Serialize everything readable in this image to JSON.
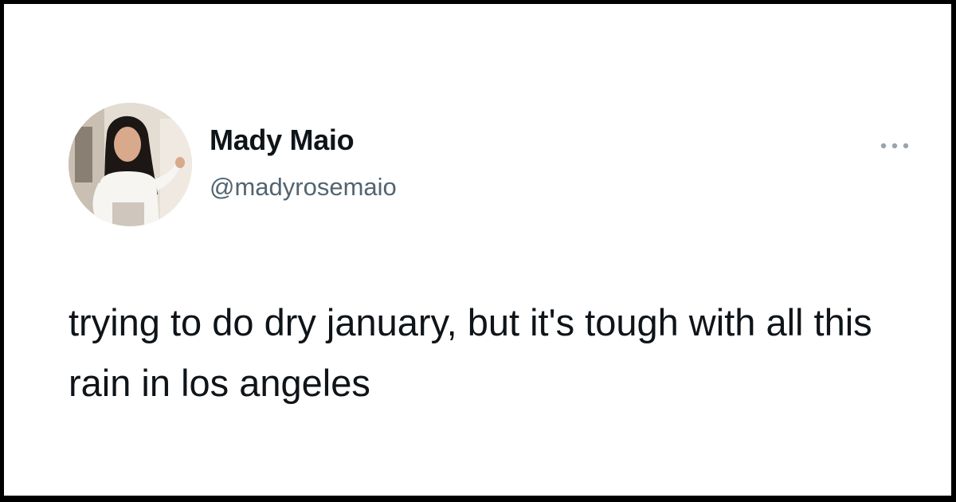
{
  "tweet": {
    "author": {
      "display_name": "Mady Maio",
      "handle": "@madyrosemaio",
      "avatar": "profile-photo"
    },
    "more_icon": "more-horizontal-icon",
    "text": "trying to do dry january, but it's tough with all this rain in los angeles"
  },
  "colors": {
    "frame": "#000000",
    "background": "#ffffff",
    "primary_text": "#0f1419",
    "secondary_text": "#536471",
    "icon": "#9aa4ad"
  }
}
